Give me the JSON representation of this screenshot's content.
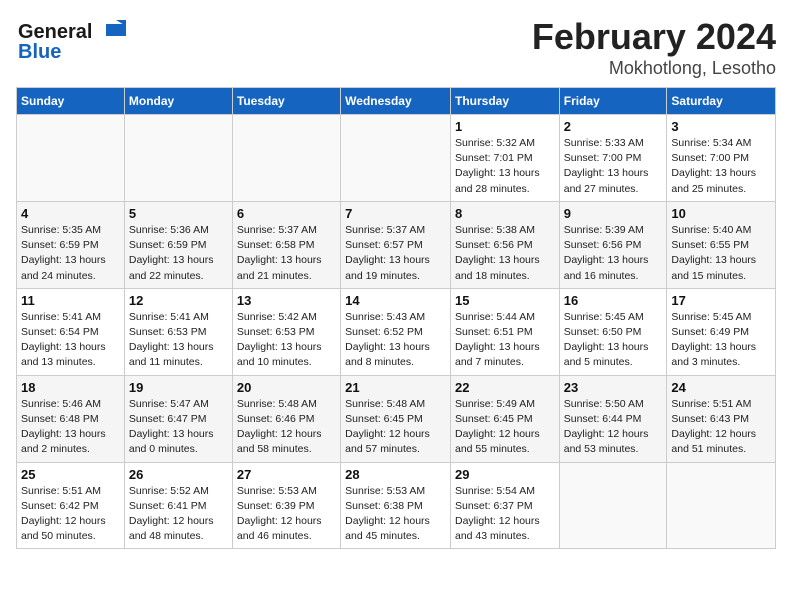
{
  "header": {
    "logo_line1": "General",
    "logo_line2": "Blue",
    "title": "February 2024",
    "subtitle": "Mokhotlong, Lesotho"
  },
  "days_of_week": [
    "Sunday",
    "Monday",
    "Tuesday",
    "Wednesday",
    "Thursday",
    "Friday",
    "Saturday"
  ],
  "weeks": [
    [
      {
        "num": "",
        "info": ""
      },
      {
        "num": "",
        "info": ""
      },
      {
        "num": "",
        "info": ""
      },
      {
        "num": "",
        "info": ""
      },
      {
        "num": "1",
        "info": "Sunrise: 5:32 AM\nSunset: 7:01 PM\nDaylight: 13 hours\nand 28 minutes."
      },
      {
        "num": "2",
        "info": "Sunrise: 5:33 AM\nSunset: 7:00 PM\nDaylight: 13 hours\nand 27 minutes."
      },
      {
        "num": "3",
        "info": "Sunrise: 5:34 AM\nSunset: 7:00 PM\nDaylight: 13 hours\nand 25 minutes."
      }
    ],
    [
      {
        "num": "4",
        "info": "Sunrise: 5:35 AM\nSunset: 6:59 PM\nDaylight: 13 hours\nand 24 minutes."
      },
      {
        "num": "5",
        "info": "Sunrise: 5:36 AM\nSunset: 6:59 PM\nDaylight: 13 hours\nand 22 minutes."
      },
      {
        "num": "6",
        "info": "Sunrise: 5:37 AM\nSunset: 6:58 PM\nDaylight: 13 hours\nand 21 minutes."
      },
      {
        "num": "7",
        "info": "Sunrise: 5:37 AM\nSunset: 6:57 PM\nDaylight: 13 hours\nand 19 minutes."
      },
      {
        "num": "8",
        "info": "Sunrise: 5:38 AM\nSunset: 6:56 PM\nDaylight: 13 hours\nand 18 minutes."
      },
      {
        "num": "9",
        "info": "Sunrise: 5:39 AM\nSunset: 6:56 PM\nDaylight: 13 hours\nand 16 minutes."
      },
      {
        "num": "10",
        "info": "Sunrise: 5:40 AM\nSunset: 6:55 PM\nDaylight: 13 hours\nand 15 minutes."
      }
    ],
    [
      {
        "num": "11",
        "info": "Sunrise: 5:41 AM\nSunset: 6:54 PM\nDaylight: 13 hours\nand 13 minutes."
      },
      {
        "num": "12",
        "info": "Sunrise: 5:41 AM\nSunset: 6:53 PM\nDaylight: 13 hours\nand 11 minutes."
      },
      {
        "num": "13",
        "info": "Sunrise: 5:42 AM\nSunset: 6:53 PM\nDaylight: 13 hours\nand 10 minutes."
      },
      {
        "num": "14",
        "info": "Sunrise: 5:43 AM\nSunset: 6:52 PM\nDaylight: 13 hours\nand 8 minutes."
      },
      {
        "num": "15",
        "info": "Sunrise: 5:44 AM\nSunset: 6:51 PM\nDaylight: 13 hours\nand 7 minutes."
      },
      {
        "num": "16",
        "info": "Sunrise: 5:45 AM\nSunset: 6:50 PM\nDaylight: 13 hours\nand 5 minutes."
      },
      {
        "num": "17",
        "info": "Sunrise: 5:45 AM\nSunset: 6:49 PM\nDaylight: 13 hours\nand 3 minutes."
      }
    ],
    [
      {
        "num": "18",
        "info": "Sunrise: 5:46 AM\nSunset: 6:48 PM\nDaylight: 13 hours\nand 2 minutes."
      },
      {
        "num": "19",
        "info": "Sunrise: 5:47 AM\nSunset: 6:47 PM\nDaylight: 13 hours\nand 0 minutes."
      },
      {
        "num": "20",
        "info": "Sunrise: 5:48 AM\nSunset: 6:46 PM\nDaylight: 12 hours\nand 58 minutes."
      },
      {
        "num": "21",
        "info": "Sunrise: 5:48 AM\nSunset: 6:45 PM\nDaylight: 12 hours\nand 57 minutes."
      },
      {
        "num": "22",
        "info": "Sunrise: 5:49 AM\nSunset: 6:45 PM\nDaylight: 12 hours\nand 55 minutes."
      },
      {
        "num": "23",
        "info": "Sunrise: 5:50 AM\nSunset: 6:44 PM\nDaylight: 12 hours\nand 53 minutes."
      },
      {
        "num": "24",
        "info": "Sunrise: 5:51 AM\nSunset: 6:43 PM\nDaylight: 12 hours\nand 51 minutes."
      }
    ],
    [
      {
        "num": "25",
        "info": "Sunrise: 5:51 AM\nSunset: 6:42 PM\nDaylight: 12 hours\nand 50 minutes."
      },
      {
        "num": "26",
        "info": "Sunrise: 5:52 AM\nSunset: 6:41 PM\nDaylight: 12 hours\nand 48 minutes."
      },
      {
        "num": "27",
        "info": "Sunrise: 5:53 AM\nSunset: 6:39 PM\nDaylight: 12 hours\nand 46 minutes."
      },
      {
        "num": "28",
        "info": "Sunrise: 5:53 AM\nSunset: 6:38 PM\nDaylight: 12 hours\nand 45 minutes."
      },
      {
        "num": "29",
        "info": "Sunrise: 5:54 AM\nSunset: 6:37 PM\nDaylight: 12 hours\nand 43 minutes."
      },
      {
        "num": "",
        "info": ""
      },
      {
        "num": "",
        "info": ""
      }
    ]
  ]
}
